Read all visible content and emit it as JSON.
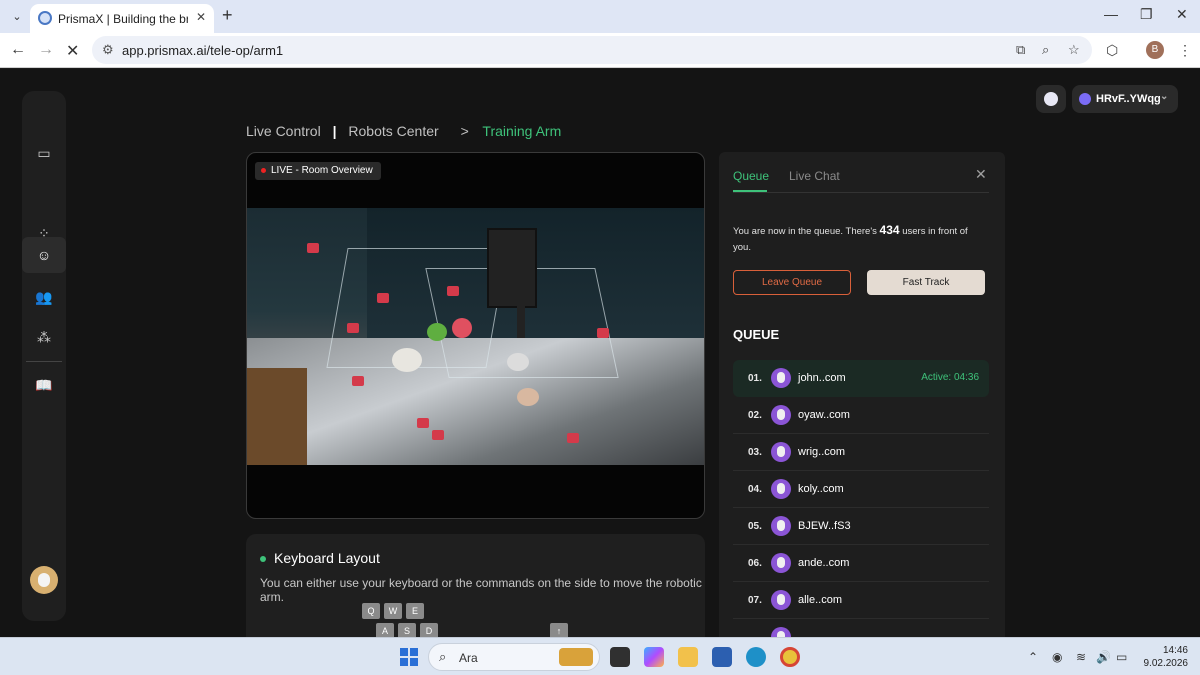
{
  "browser": {
    "tab_title": "PrismaX | Building the bridge be",
    "url": "app.prismax.ai/tele-op/arm1",
    "profile_initial": "B"
  },
  "header": {
    "wallet_label": "HRvF..YWqg"
  },
  "breadcrumb": {
    "item1": "Live Control",
    "separator": "|",
    "item2": "Robots Center",
    "arrow": ">",
    "current": "Training Arm"
  },
  "video": {
    "live_badge": "LIVE - Room Overview"
  },
  "keyboard": {
    "title": "Keyboard Layout",
    "description": "You can either use your keyboard or the commands on the side to move the robotic arm.",
    "keys": [
      "Q",
      "W",
      "E",
      "A",
      "S",
      "D",
      "↑"
    ]
  },
  "queue_panel": {
    "tab_queue": "Queue",
    "tab_chat": "Live Chat",
    "info_prefix": "You are now in the queue. There's",
    "users_ahead": "434",
    "info_suffix": "users in front of you.",
    "leave_button": "Leave Queue",
    "fast_track_button": "Fast Track",
    "heading": "QUEUE",
    "rows": [
      {
        "num": "01.",
        "name": "john..com",
        "status": "Active: 04:36"
      },
      {
        "num": "02.",
        "name": "oyaw..com",
        "status": ""
      },
      {
        "num": "03.",
        "name": "wrig..com",
        "status": ""
      },
      {
        "num": "04.",
        "name": "koly..com",
        "status": ""
      },
      {
        "num": "05.",
        "name": "BJEW..fS3",
        "status": ""
      },
      {
        "num": "06.",
        "name": "ande..com",
        "status": ""
      },
      {
        "num": "07.",
        "name": "alle..com",
        "status": ""
      }
    ]
  },
  "taskbar": {
    "search_placeholder": "Ara",
    "time": "14:46",
    "date": "9.02.2026"
  },
  "colors": {
    "accent_green": "#3ec27a",
    "leave_orange": "#e06a45",
    "background": "#141414"
  }
}
